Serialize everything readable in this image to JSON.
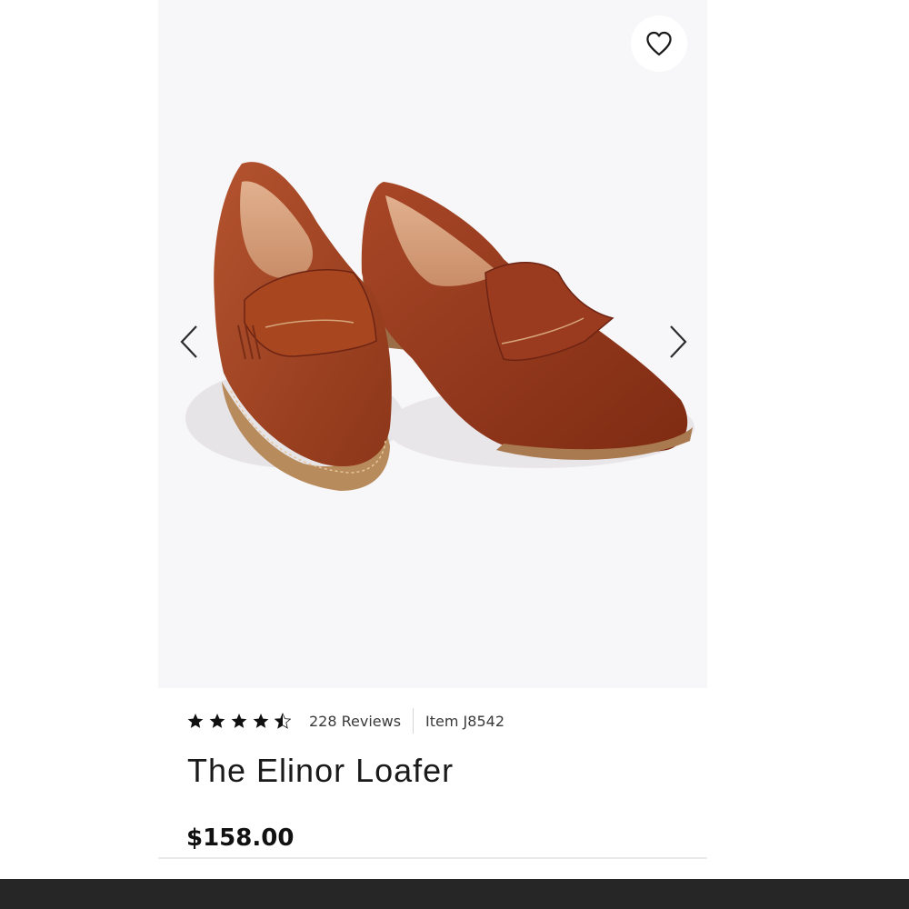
{
  "product": {
    "title": "The Elinor Loafer",
    "price": "$158.00",
    "rating": 4.5,
    "rating_max": 5,
    "reviews_label": "228 Reviews",
    "item_label": "Item J8542"
  },
  "gallery": {
    "image_alt": "The Elinor Loafer in brown leather",
    "favorite_icon": "heart-outline-icon",
    "prev_icon": "chevron-left-icon",
    "next_icon": "chevron-right-icon"
  },
  "colors": {
    "leather": "#a3482a",
    "leather_dark": "#6e2414",
    "sole": "#b78a5c",
    "gallery_bg": "#f7f6f8",
    "bottom_bar": "#262626"
  }
}
